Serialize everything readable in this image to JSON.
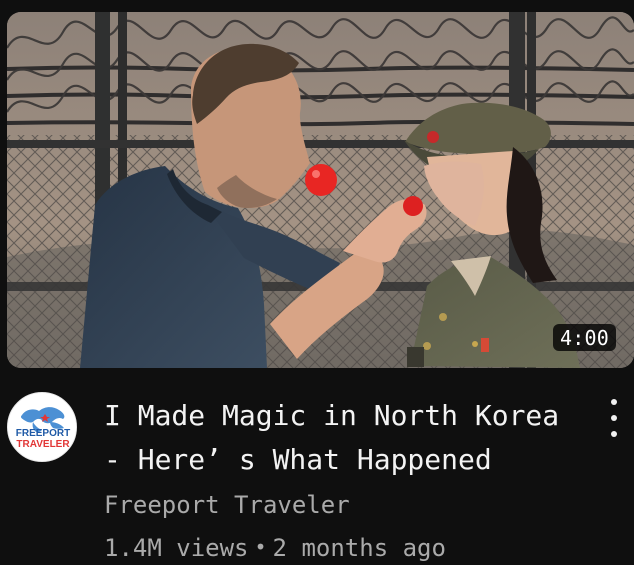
{
  "video": {
    "duration": "4:00",
    "title": "I Made Magic in North Korea - Here’ s What Happened",
    "channel": "Freeport Traveler",
    "views": "1.4M views",
    "separator": "•",
    "age": "2 months ago"
  },
  "channel_avatar": {
    "top_text": "FREEPORT",
    "bottom_text": "TRAVELER",
    "icon": "world-map-logo-icon"
  },
  "actions": {
    "menu_icon": "more-vertical-icon"
  },
  "colors": {
    "background": "#0f0f0f",
    "primary_text": "#f1f1f1",
    "secondary_text": "#aaaaaa",
    "duration_badge": "#000000"
  }
}
